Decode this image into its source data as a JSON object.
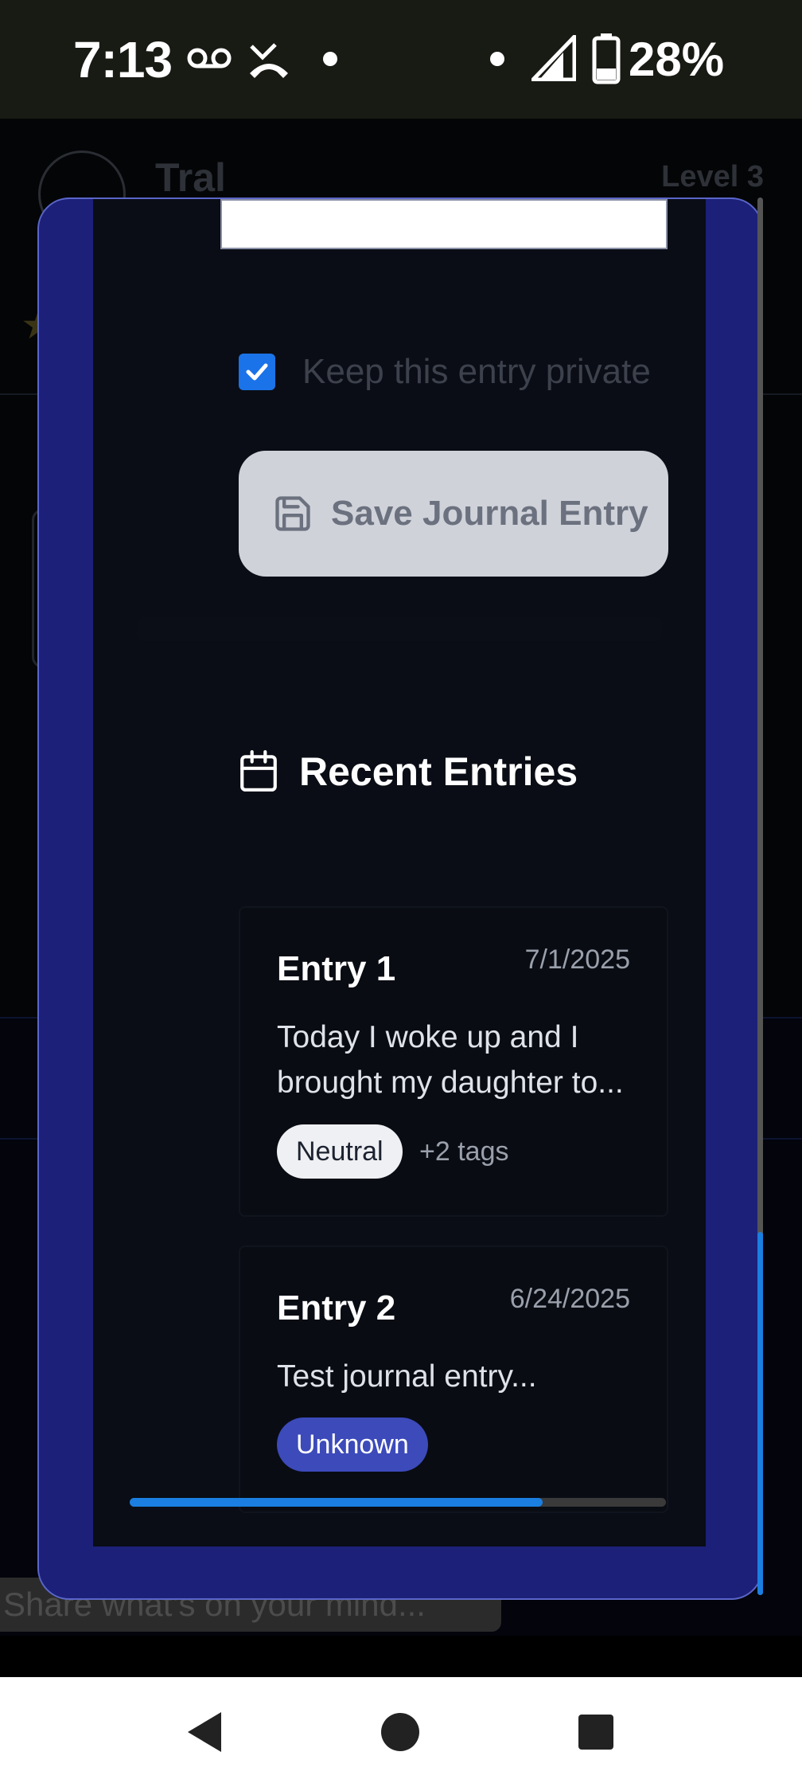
{
  "status_bar": {
    "time": "7:13",
    "battery": "28%",
    "icons": [
      "voicemail-icon",
      "missed-call-icon",
      "notification-dot-icon",
      "signal-icon",
      "battery-icon"
    ]
  },
  "background": {
    "app_user": "Tral",
    "level": "Level 3",
    "composer_placeholder": "Share what's on your mind..."
  },
  "journal": {
    "private_label": "Keep this entry private",
    "private_checked": true,
    "save_label": "Save Journal Entry"
  },
  "recent": {
    "title": "Recent Entries",
    "entries": [
      {
        "title": "Entry 1",
        "date": "7/1/2025",
        "preview": "Today I woke up and I brought my daughter to...",
        "tag": "Neutral",
        "more_tags": "+2 tags"
      },
      {
        "title": "Entry 2",
        "date": "6/24/2025",
        "preview": "Test journal entry...",
        "tag": "Unknown"
      }
    ]
  },
  "scroll": {
    "horizontal_progress": 0.77,
    "vertical_thumb_start": 0.74,
    "vertical_thumb_end": 1.0
  },
  "colors": {
    "accent": "#1a73e8",
    "modal_frame": "#1c2079",
    "unknown_tag": "#3c4aba"
  }
}
